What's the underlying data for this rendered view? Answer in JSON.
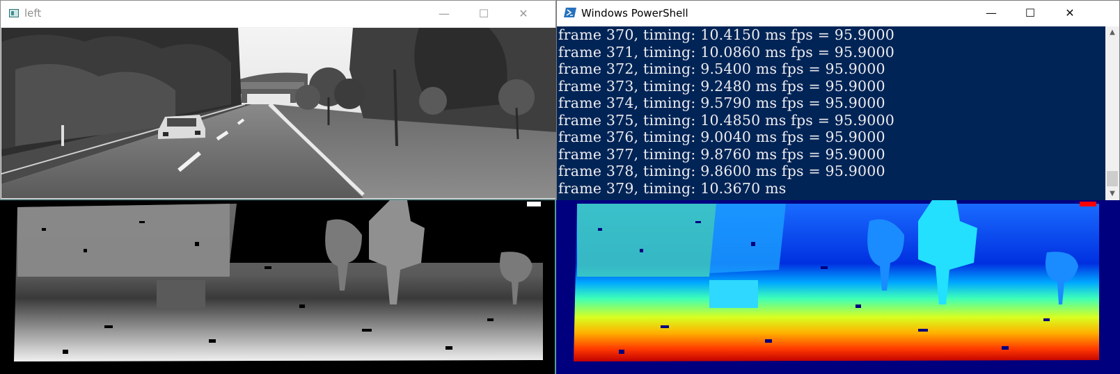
{
  "left_window": {
    "title": "left",
    "icons": {
      "app": "opencv-window-icon",
      "minimize": "minimize-icon",
      "maximize": "maximize-icon",
      "close": "close-icon"
    },
    "controls": {
      "minimize": "—",
      "maximize": "☐",
      "close": "✕"
    },
    "content": "grayscale road scene image (car on two-lane road, trees, overpass)"
  },
  "powershell_window": {
    "title": "Windows PowerShell",
    "colors": {
      "background": "#012456",
      "text": "#eeedf0"
    },
    "controls": {
      "minimize": "—",
      "maximize": "☐",
      "close": "✕"
    },
    "lines": [
      "frame 370, timing: 10.4150 ms fps = 95.9000",
      "frame 371, timing: 10.0860 ms fps = 95.9000",
      "frame 372, timing: 9.5400 ms fps = 95.9000",
      "frame 373, timing: 9.2480 ms fps = 95.9000",
      "frame 374, timing: 9.5790 ms fps = 95.9000",
      "frame 375, timing: 10.4850 ms fps = 95.9000",
      "frame 376, timing: 9.0040 ms fps = 95.9000",
      "frame 377, timing: 9.8760 ms fps = 95.9000",
      "frame 378, timing: 9.8600 ms fps = 95.9000",
      "frame 379, timing: 10.3670 ms"
    ],
    "scrollbar": {
      "up": "▲",
      "down": "▼"
    }
  },
  "disparity_gray": {
    "content": "grayscale disparity map"
  },
  "disparity_color": {
    "content": "jet colormap disparity map"
  }
}
